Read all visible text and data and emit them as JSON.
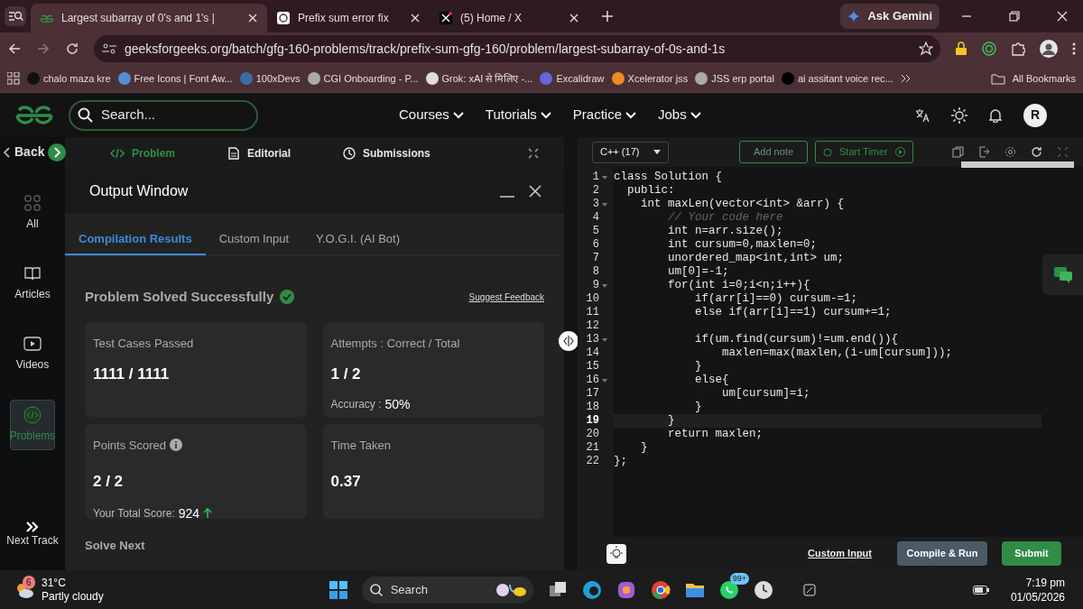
{
  "browser": {
    "tabs": [
      {
        "title": "Largest subarray of 0's and 1's |",
        "selected": true
      },
      {
        "title": "Prefix sum error fix",
        "selected": false
      },
      {
        "title": "(5) Home / X",
        "selected": false
      }
    ],
    "ask_button": "Ask Gemini",
    "url": "geeksforgeeks.org/batch/gfg-160-problems/track/prefix-sum-gfg-160/problem/largest-subarray-of-0s-and-1s",
    "bookmarks": [
      {
        "label": "chalo maza kre",
        "color": "#111111"
      },
      {
        "label": "Free Icons | Font Aw...",
        "color": "#538dd7"
      },
      {
        "label": "100xDevs",
        "color": "#3a6ea5"
      },
      {
        "label": "CGI Onboarding - P...",
        "color": "#aaaaaa"
      },
      {
        "label": "Grok: xAI से मिलिए -...",
        "color": "#dddddd"
      },
      {
        "label": "Excalidraw",
        "color": "#6965db"
      },
      {
        "label": "Xcelerator jss",
        "color": "#f08a24"
      },
      {
        "label": "JSS erp portal",
        "color": "#aaaaaa"
      },
      {
        "label": "ai assitant voice rec...",
        "color": "#000000"
      }
    ],
    "all_bookmarks": "All Bookmarks"
  },
  "site_header": {
    "search_placeholder": "Search...",
    "nav": [
      "Courses",
      "Tutorials",
      "Practice",
      "Jobs"
    ],
    "avatar": "R"
  },
  "sidebar": {
    "back": "Back",
    "items": [
      {
        "label": "All",
        "selected": false
      },
      {
        "label": "Articles",
        "selected": false
      },
      {
        "label": "Videos",
        "selected": false
      },
      {
        "label": "Problems",
        "selected": true
      }
    ],
    "next_track": "Next Track"
  },
  "problem_tabs": [
    {
      "label": "Problem",
      "selected": true
    },
    {
      "label": "Editorial",
      "selected": false
    },
    {
      "label": "Submissions",
      "selected": false
    }
  ],
  "output_window": {
    "title": "Output Window",
    "tabs": [
      {
        "label": "Compilation Results",
        "selected": true
      },
      {
        "label": "Custom Input",
        "selected": false
      },
      {
        "label": "Y.O.G.I. (AI Bot)",
        "selected": false
      }
    ],
    "status": "Problem Solved Successfully",
    "feedback_link": "Suggest Feedback",
    "cards": [
      {
        "label": "Test Cases Passed",
        "value": "1111 / 1111"
      },
      {
        "label": "Attempts : Correct / Total",
        "value": "1 / 2",
        "note_label": "Accuracy :",
        "note_value": "50%"
      },
      {
        "label": "Points Scored",
        "value": "2 / 2",
        "note_label": "Your Total Score:",
        "note_value": "924"
      },
      {
        "label": "Time Taken",
        "value": "0.37"
      }
    ],
    "solve_next": "Solve Next"
  },
  "editor": {
    "language": "C++ (17)",
    "add_note": "Add note",
    "timer": "Start Timer",
    "lines": [
      {
        "number": "1",
        "text": "class Solution {",
        "kind": "code",
        "foldable": true,
        "current": false
      },
      {
        "number": "2",
        "text": "  public:",
        "kind": "code",
        "foldable": false,
        "current": false
      },
      {
        "number": "3",
        "text": "    int maxLen(vector<int> &arr) {",
        "kind": "code",
        "foldable": true,
        "current": false
      },
      {
        "number": "4",
        "text": "        // Your code here",
        "kind": "comment",
        "foldable": false,
        "current": false
      },
      {
        "number": "5",
        "text": "        int n=arr.size();",
        "kind": "code",
        "foldable": false,
        "current": false
      },
      {
        "number": "6",
        "text": "        int cursum=0,maxlen=0;",
        "kind": "code",
        "foldable": false,
        "current": false
      },
      {
        "number": "7",
        "text": "        unordered_map<int,int> um;",
        "kind": "code",
        "foldable": false,
        "current": false
      },
      {
        "number": "8",
        "text": "        um[0]=-1;",
        "kind": "code",
        "foldable": false,
        "current": false
      },
      {
        "number": "9",
        "text": "        for(int i=0;i<n;i++){",
        "kind": "code",
        "foldable": true,
        "current": false
      },
      {
        "number": "10",
        "text": "            if(arr[i]==0) cursum-=1;",
        "kind": "code",
        "foldable": false,
        "current": false
      },
      {
        "number": "11",
        "text": "            else if(arr[i]==1) cursum+=1;",
        "kind": "code",
        "foldable": false,
        "current": false
      },
      {
        "number": "12",
        "kind": "code",
        "foldable": false,
        "current": false
      },
      {
        "number": "13",
        "text": "            if(um.find(cursum)!=um.end()){",
        "kind": "code",
        "foldable": true,
        "current": false
      },
      {
        "number": "14",
        "text": "                maxlen=max(maxlen,(i-um[cursum]));",
        "kind": "code",
        "foldable": false,
        "current": false
      },
      {
        "number": "15",
        "text": "            }",
        "kind": "code",
        "foldable": false,
        "current": false
      },
      {
        "number": "16",
        "text": "            else{",
        "kind": "code",
        "foldable": true,
        "current": false
      },
      {
        "number": "17",
        "text": "                um[cursum]=i;",
        "kind": "code",
        "foldable": false,
        "current": false
      },
      {
        "number": "18",
        "text": "            }",
        "kind": "code",
        "foldable": false,
        "current": false
      },
      {
        "number": "19",
        "text": "        }",
        "kind": "code",
        "foldable": false,
        "current": true
      },
      {
        "number": "20",
        "text": "        return maxlen;",
        "kind": "code",
        "foldable": false,
        "current": false
      },
      {
        "number": "21",
        "text": "    }",
        "kind": "code",
        "foldable": false,
        "current": false
      },
      {
        "number": "22",
        "text": "};",
        "kind": "code",
        "foldable": false,
        "current": false
      }
    ],
    "custom_input": "Custom Input",
    "compile_button": "Compile & Run",
    "submit_button": "Submit"
  },
  "taskbar": {
    "weather": {
      "temperature": "31°C",
      "condition": "Partly cloudy",
      "badge": "6"
    },
    "search": "Search",
    "whatsapp_badge": "99+",
    "time": "7:19 pm",
    "date": "01/05/2026"
  }
}
